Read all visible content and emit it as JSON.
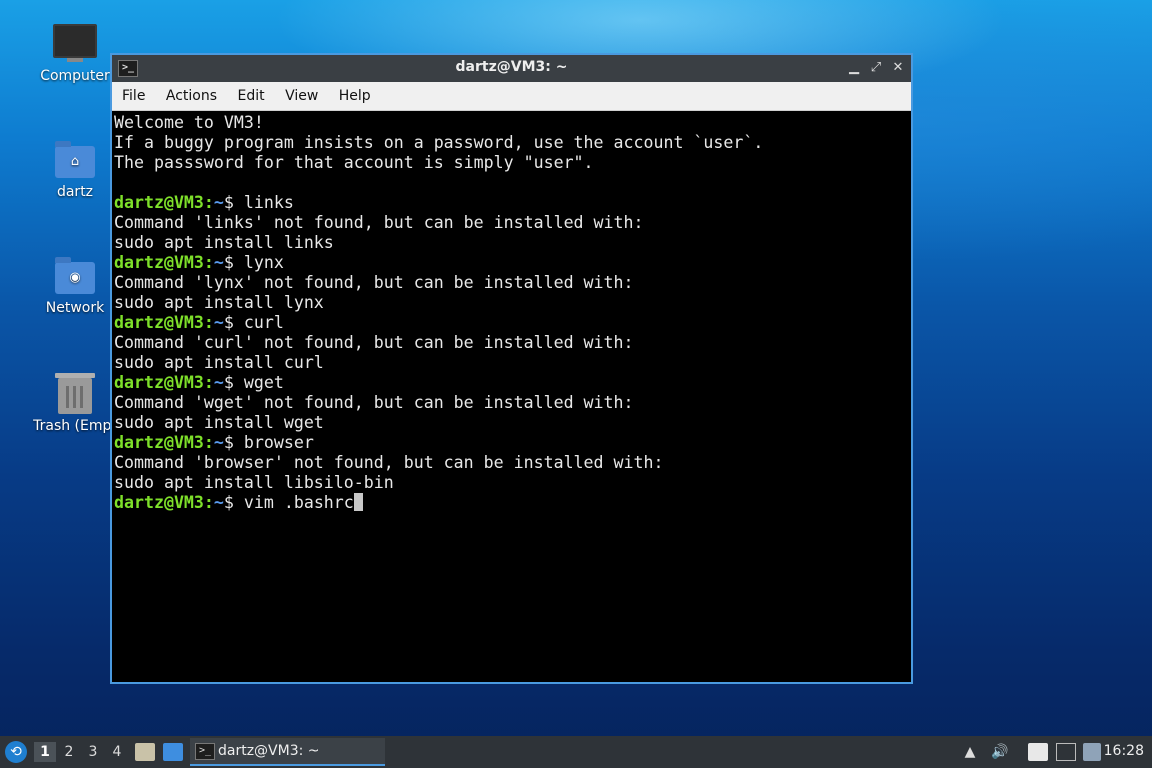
{
  "desktop": {
    "icons": [
      {
        "label": "Computer",
        "icon": "computer-icon"
      },
      {
        "label": "dartz",
        "icon": "home-folder-icon"
      },
      {
        "label": "Network",
        "icon": "network-folder-icon"
      },
      {
        "label": "Trash (Empt",
        "icon": "trash-icon"
      }
    ]
  },
  "window": {
    "title": "dartz@VM3: ~",
    "controls": {
      "minimize": "▁",
      "maximize": "⤢",
      "close": "✕"
    },
    "menu": [
      "File",
      "Actions",
      "Edit",
      "View",
      "Help"
    ]
  },
  "terminal": {
    "prompt_user": "dartz@VM3",
    "prompt_sep": ":",
    "prompt_path": "~",
    "prompt_end": "$ ",
    "lines": [
      {
        "type": "text",
        "text": "Welcome to VM3!"
      },
      {
        "type": "text",
        "text": "If a buggy program insists on a password, use the account `user`."
      },
      {
        "type": "text",
        "text": "The passsword for that account is simply \"user\"."
      },
      {
        "type": "text",
        "text": ""
      },
      {
        "type": "prompt",
        "cmd": "links"
      },
      {
        "type": "text",
        "text": "Command 'links' not found, but can be installed with:"
      },
      {
        "type": "text",
        "text": "sudo apt install links"
      },
      {
        "type": "prompt",
        "cmd": "lynx"
      },
      {
        "type": "text",
        "text": "Command 'lynx' not found, but can be installed with:"
      },
      {
        "type": "text",
        "text": "sudo apt install lynx"
      },
      {
        "type": "prompt",
        "cmd": "curl"
      },
      {
        "type": "text",
        "text": "Command 'curl' not found, but can be installed with:"
      },
      {
        "type": "text",
        "text": "sudo apt install curl"
      },
      {
        "type": "prompt",
        "cmd": "wget"
      },
      {
        "type": "text",
        "text": "Command 'wget' not found, but can be installed with:"
      },
      {
        "type": "text",
        "text": "sudo apt install wget"
      },
      {
        "type": "prompt",
        "cmd": "browser"
      },
      {
        "type": "text",
        "text": "Command 'browser' not found, but can be installed with:"
      },
      {
        "type": "text",
        "text": "sudo apt install libsilo-bin"
      },
      {
        "type": "prompt",
        "cmd": "vim .bashrc",
        "cursor": true
      }
    ]
  },
  "taskbar": {
    "workspaces": [
      "1",
      "2",
      "3",
      "4"
    ],
    "active_workspace": "1",
    "task_label": "dartz@VM3: ~",
    "clock": "16:28",
    "colors": {
      "accent": "#4a9ae0",
      "prompt_user": "#7ee02a",
      "prompt_path": "#5a9cf0"
    }
  }
}
